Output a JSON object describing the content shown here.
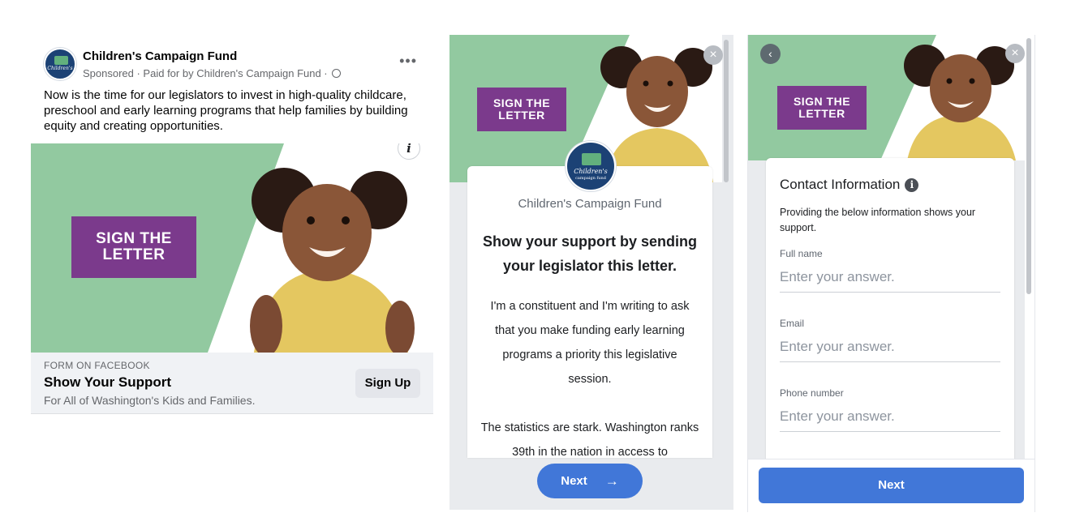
{
  "ad": {
    "page_name": "Children's Campaign Fund",
    "meta": "Sponsored · Paid for by Children's Campaign Fund ·",
    "more_icon": "more-dots-icon",
    "body_text": "Now is the time for our legislators to invest in high-quality childcare, preschool and early learning programs that help families by building equity and creating opportunities.",
    "image_sign": "SIGN THE LETTER",
    "info_icon": "i",
    "cta": {
      "label": "FORM ON FACEBOOK",
      "title": "Show Your Support",
      "description": "For All of Washington's Kids and Families.",
      "button": "Sign Up"
    }
  },
  "logo_text": "Children's",
  "logo_subtext": "campaign fund",
  "intro": {
    "image_sign": "SIGN THE LETTER",
    "org_name": "Children's Campaign Fund",
    "headline": "Show your support by sending your legislator this letter.",
    "paragraph_1": "I'm a constituent and I'm writing to ask that you make funding early learning programs a priority this legislative session.",
    "paragraph_2": "The statistics are stark. Washington ranks 39th in the nation in access to",
    "close_glyph": "×",
    "next_label": "Next",
    "next_arrow": "→"
  },
  "contact": {
    "image_sign": "SIGN THE LETTER",
    "back_glyph": "‹",
    "close_glyph": "×",
    "title": "Contact Information",
    "info_glyph": "i",
    "description": "Providing the below information shows your support.",
    "fields": [
      {
        "label": "Full name",
        "placeholder": "Enter your answer."
      },
      {
        "label": "Email",
        "placeholder": "Enter your answer."
      },
      {
        "label": "Phone number",
        "placeholder": "Enter your answer."
      }
    ],
    "next_label": "Next"
  },
  "colors": {
    "brand_green": "#92c9a0",
    "sign_purple": "#7b3a8c",
    "button_blue": "#4177d8",
    "logo_navy": "#1c4275"
  }
}
